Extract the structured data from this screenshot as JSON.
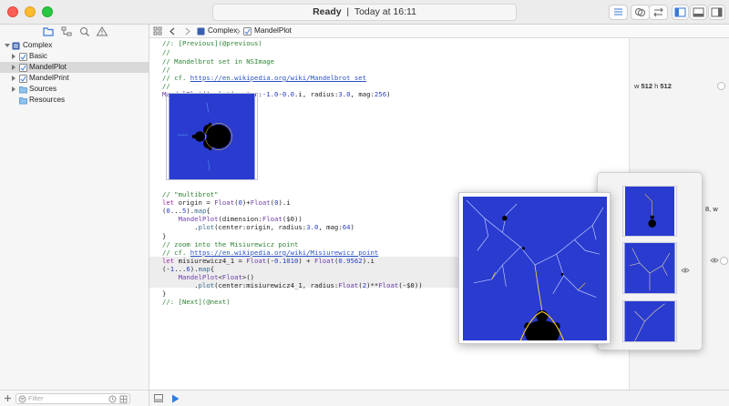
{
  "window": {
    "status": "Ready",
    "timestamp": "Today at 16:11"
  },
  "navigator": {
    "items": [
      {
        "label": "Complex",
        "kind": "playground",
        "expanded": true
      },
      {
        "label": "Basic",
        "kind": "page"
      },
      {
        "label": "MandelPlot",
        "kind": "page",
        "selected": true
      },
      {
        "label": "MandelPrint",
        "kind": "page"
      },
      {
        "label": "Sources",
        "kind": "folder"
      },
      {
        "label": "Resources",
        "kind": "folder"
      }
    ],
    "filter_placeholder": "Filter"
  },
  "jumpbar": {
    "crumbs": [
      "Complex",
      "MandelPlot"
    ]
  },
  "code": {
    "l1": "//: [Previous](@previous)",
    "l2": "//",
    "l3": "// Mandelbrot set in NSImage",
    "l4": "//",
    "l5_prefix": "// cf. ",
    "l5_link": "https://en.wikipedia.org/wiki/Mandelbrot_set",
    "l6": "//",
    "l7a": "MandelPlot",
    "l7b": "().",
    "l7c": "plot",
    "l7d": "(center:",
    "l7e": "-1.0",
    "l7f": "-",
    "l7g": "0.0",
    "l7h": ".i, radius:",
    "l7i": "3.0",
    "l7j": ", mag:",
    "l7k": "256",
    "l7l": ")",
    "l8": "// \"multibrot\"",
    "l9a": "let",
    "l9b": " origin = ",
    "l9c": "Float",
    "l9d": "(",
    "l9e": "0",
    "l9f": ")+",
    "l9g": "Float",
    "l9h": "(",
    "l9i": "0",
    "l9j": ").i",
    "l10a": "(",
    "l10b": "0",
    "l10c": "...",
    "l10d": "5",
    "l10e": ").",
    "l10f": "map",
    "l10g": "{",
    "l11a": "    MandelPlot",
    "l11b": "(dimension:",
    "l11c": "Float",
    "l11d": "($0))",
    "l12a": "        .",
    "l12b": "plot",
    "l12c": "(center:origin, radius:",
    "l12d": "3.0",
    "l12e": ", mag:",
    "l12f": "64",
    "l12g": ")",
    "l13": "}",
    "l14": "// zoom into the Misiurewicz point",
    "l15_prefix": "// cf. ",
    "l15_link": "https://en.wikipedia.org/wiki/Misiurewicz_point",
    "l16a": "let",
    "l16b": " misiurewicz4_1 = ",
    "l16c": "Float",
    "l16d": "(-",
    "l16e": "0.1010",
    "l16f": ") + ",
    "l16g": "Float",
    "l16h": "(",
    "l16i": "0.9562",
    "l16j": ").i",
    "l17a": "(-",
    "l17b": "1",
    "l17c": "...",
    "l17d": "6",
    "l17e": ").",
    "l17f": "map",
    "l17g": "{",
    "l18a": "    MandelPlot",
    "l18b": "<",
    "l18c": "Float",
    "l18d": ">()",
    "l19a": "        .",
    "l19b": "plot",
    "l19c": "(center:misiurewicz4_1, radius:",
    "l19d": "Float",
    "l19e": "(",
    "l19f": "2",
    "l19g": ")**",
    "l19h": "Float",
    "l19i": "(-$0))",
    "l20": "}",
    "l21": "//: [Next](@next)"
  },
  "results": {
    "dim_w_label": "w",
    "dim_w": "512",
    "dim_h_label": "h",
    "dim_h": "512",
    "partial_text": "8, w"
  },
  "colors": {
    "fractal_background": "#2a3bd0",
    "fractal_set": "#000000",
    "comment": "#2f8236",
    "keyword": "#a22aa2",
    "number": "#2b3fc0",
    "selection": "#d9d9d9"
  },
  "icons": [
    "folder-icon",
    "warning-icon",
    "search-icon",
    "bookmark-icon",
    "play-icon",
    "eye-icon",
    "add-icon",
    "clock-icon",
    "grid-icon"
  ]
}
